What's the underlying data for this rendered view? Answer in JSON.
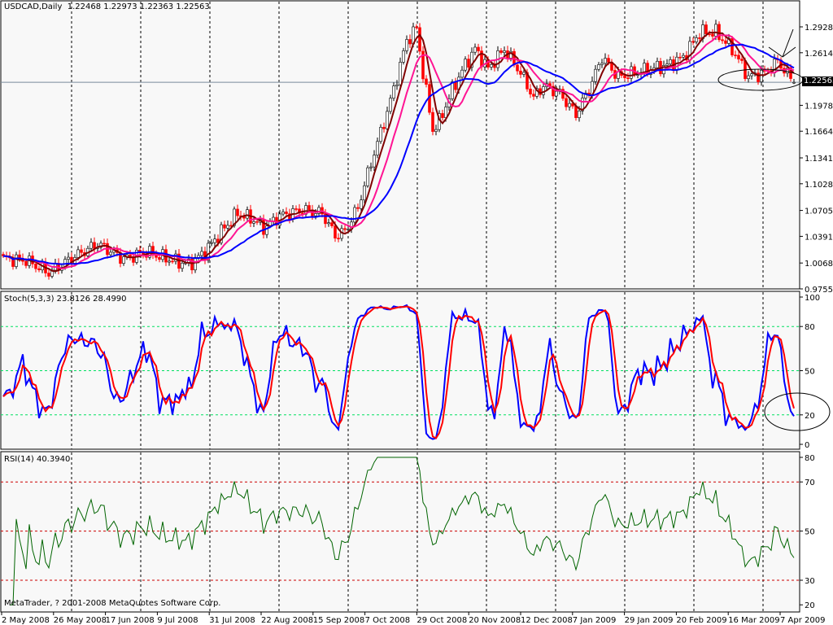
{
  "header": {
    "symbol": "USDCAD,Daily",
    "ohlc": "1.22468 1.22973 1.22363 1.22563"
  },
  "stoch_panel": {
    "label": "Stoch(5,3,3) 23.8126 28.4990",
    "levels": [
      80,
      50,
      20
    ],
    "axis": [
      "100",
      "80",
      "50",
      "20",
      "0"
    ]
  },
  "rsi_panel": {
    "label": "RSI(14) 40.3940",
    "levels": [
      70,
      50,
      30
    ],
    "axis": [
      "80",
      "70",
      "50",
      "30",
      "20"
    ]
  },
  "copyright": "MetaTrader, ? 2001-2008 MetaQuotes Software Corp.",
  "current_price_label": "1.22563",
  "colors": {
    "background": "#f8f8f8",
    "bull": "#ffffff",
    "bear": "#ff0000",
    "ma_fast": "#800000",
    "ma_mid": "#ff1493",
    "ma_slow": "#0000ff",
    "stoch_main": "#0000ff",
    "stoch_signal": "#ff0000",
    "rsi": "#006400",
    "stoch_level": "#00e060",
    "rsi_level": "#cc0000"
  },
  "chart_data": {
    "type": "candlestick",
    "title": "USDCAD,Daily",
    "price_axis": [
      "1.29280",
      "1.26145",
      "1.19780",
      "1.16645",
      "1.13415",
      "1.10280",
      "1.07050",
      "1.03915",
      "1.00685",
      "0.97550"
    ],
    "ylim": [
      0.9755,
      1.2928
    ],
    "x_tick_labels": [
      "2 May 2008",
      "26 May 2008",
      "17 Jun 2008",
      "9 Jul 2008",
      "31 Jul 2008",
      "22 Aug 2008",
      "15 Sep 2008",
      "7 Oct 2008",
      "29 Oct 2008",
      "20 Nov 2008",
      "12 Dec 2008",
      "7 Jan 2009",
      "29 Jan 2009",
      "20 Feb 2009",
      "16 Mar 2009",
      "7 Apr 2009"
    ],
    "bars": 244,
    "close_anchors": [
      [
        0,
        1.012
      ],
      [
        7,
        1.01
      ],
      [
        14,
        0.995
      ],
      [
        22,
        1.015
      ],
      [
        29,
        1.03
      ],
      [
        37,
        1.012
      ],
      [
        44,
        1.02
      ],
      [
        52,
        1.01
      ],
      [
        57,
        1.005
      ],
      [
        62,
        1.02
      ],
      [
        67,
        1.045
      ],
      [
        72,
        1.067
      ],
      [
        77,
        1.059
      ],
      [
        80,
        1.049
      ],
      [
        85,
        1.064
      ],
      [
        92,
        1.071
      ],
      [
        98,
        1.067
      ],
      [
        102,
        1.04
      ],
      [
        105,
        1.045
      ],
      [
        109,
        1.074
      ],
      [
        113,
        1.128
      ],
      [
        117,
        1.177
      ],
      [
        120,
        1.217
      ],
      [
        124,
        1.276
      ],
      [
        127,
        1.291
      ],
      [
        129,
        1.237
      ],
      [
        132,
        1.168
      ],
      [
        134,
        1.178
      ],
      [
        138,
        1.217
      ],
      [
        142,
        1.247
      ],
      [
        145,
        1.266
      ],
      [
        149,
        1.242
      ],
      [
        154,
        1.266
      ],
      [
        159,
        1.237
      ],
      [
        163,
        1.207
      ],
      [
        166,
        1.222
      ],
      [
        171,
        1.212
      ],
      [
        176,
        1.187
      ],
      [
        180,
        1.217
      ],
      [
        184,
        1.256
      ],
      [
        189,
        1.232
      ],
      [
        194,
        1.237
      ],
      [
        199,
        1.242
      ],
      [
        204,
        1.246
      ],
      [
        209,
        1.256
      ],
      [
        214,
        1.286
      ],
      [
        219,
        1.286
      ],
      [
        224,
        1.266
      ],
      [
        229,
        1.232
      ],
      [
        234,
        1.237
      ],
      [
        238,
        1.251
      ],
      [
        243,
        1.22563
      ]
    ],
    "last_bar": {
      "open": 1.22468,
      "high": 1.22973,
      "low": 1.22363,
      "close": 1.22563
    },
    "indicators": [
      "MA fast",
      "MA mid",
      "MA slow",
      "Stochastic(5,3,3)",
      "RSI(14)"
    ]
  }
}
